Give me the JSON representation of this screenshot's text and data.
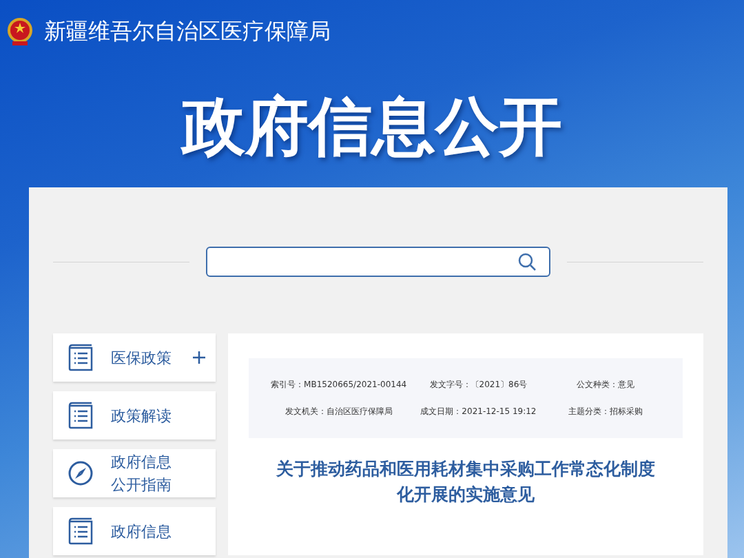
{
  "header": {
    "site_name": "新疆维吾尔自治区医疗保障局",
    "banner_title": "政府信息公开"
  },
  "sidebar": {
    "items": [
      {
        "label": "医保政策",
        "kind": "book",
        "has_children": true
      },
      {
        "label": "政策解读",
        "kind": "book",
        "has_children": false
      },
      {
        "label": "政府信息公开指南",
        "kind": "compass",
        "has_children": false
      },
      {
        "label": "政府信息",
        "kind": "book",
        "has_children": false
      }
    ]
  },
  "document": {
    "meta": [
      {
        "label": "索引号：",
        "value": "MB1520665/2021-00144"
      },
      {
        "label": "发文字号：",
        "value": "〔2021〕86号"
      },
      {
        "label": "公文种类：",
        "value": "意见"
      },
      {
        "label": "发文机关：",
        "value": "自治区医疗保障局"
      },
      {
        "label": "成文日期：",
        "value": "2021-12-15 19:12"
      },
      {
        "label": "主题分类：",
        "value": "招标采购"
      }
    ],
    "title": "关于推动药品和医用耗材集中采购工作常态化制度化开展的实施意见"
  }
}
